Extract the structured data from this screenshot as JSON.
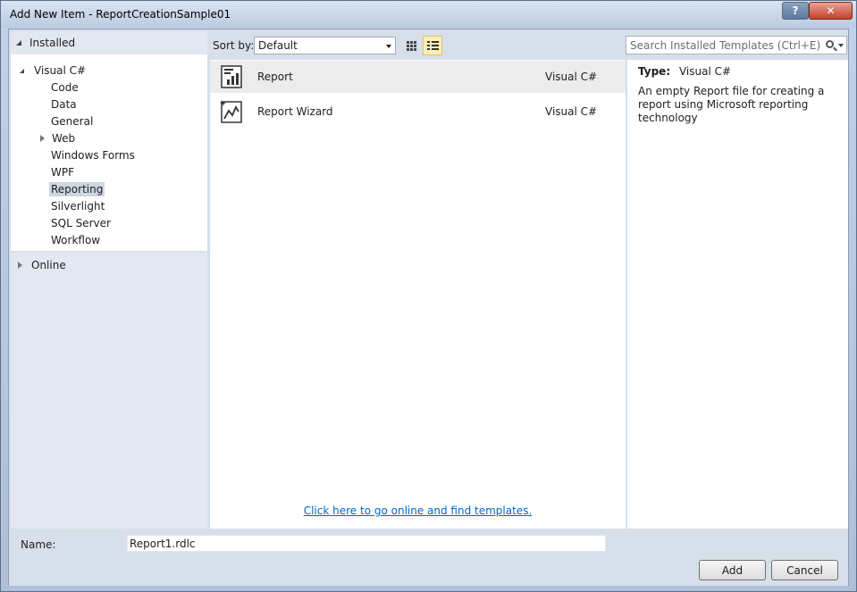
{
  "window": {
    "title": "Add New Item - ReportCreationSample01",
    "help_label": "?",
    "close_label": "✕"
  },
  "tree": {
    "installed_label": "Installed",
    "root_label": "Visual C#",
    "children": [
      "Code",
      "Data",
      "General",
      "Web",
      "Windows Forms",
      "WPF",
      "Reporting",
      "Silverlight",
      "SQL Server",
      "Workflow"
    ],
    "selected": "Reporting",
    "online_label": "Online"
  },
  "toolbar": {
    "sort_label": "Sort by:",
    "sort_value": "Default",
    "search_placeholder": "Search Installed Templates (Ctrl+E)"
  },
  "templates": [
    {
      "name": "Report",
      "language": "Visual C#",
      "icon": "report-icon"
    },
    {
      "name": "Report Wizard",
      "language": "Visual C#",
      "icon": "report-wizard-icon"
    }
  ],
  "online_link": "Click here to go online and find templates.",
  "details": {
    "type_label": "Type:",
    "type_value": "Visual C#",
    "description": "An empty Report file for creating a report using Microsoft reporting technology"
  },
  "bottom": {
    "name_label": "Name:",
    "name_value": "Report1.rdlc",
    "add_label": "Add",
    "cancel_label": "Cancel"
  },
  "colors": {
    "selection_bg": "#cfd6e2",
    "link": "#0066cc",
    "close_button": "#c4412c"
  }
}
